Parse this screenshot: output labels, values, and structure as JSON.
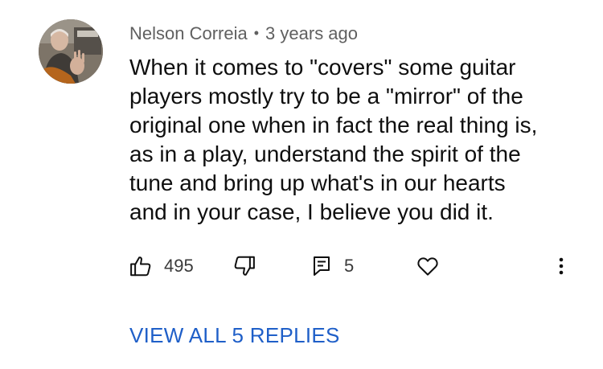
{
  "comment": {
    "author": "Nelson Correia",
    "separator": "•",
    "timestamp": "3 years ago",
    "text_lines": [
      "When it comes to \"covers\" some guitar",
      "players mostly try to be a \"mirror\" of the",
      "original one when in fact the real thing is,",
      "as in a play, understand the spirit of the",
      "tune and bring up what's in our hearts",
      "and in your case, I believe you did it."
    ],
    "like_count": "495",
    "reply_count": "5",
    "view_replies_label": "VIEW ALL 5 REPLIES"
  },
  "icons": {
    "like": "thumbs-up-icon",
    "dislike": "thumbs-down-icon",
    "reply": "comment-icon",
    "heart": "heart-icon",
    "more": "more-vertical-icon"
  },
  "colors": {
    "text": "#0f0f0f",
    "meta": "#606060",
    "link": "#1f5fc8"
  }
}
